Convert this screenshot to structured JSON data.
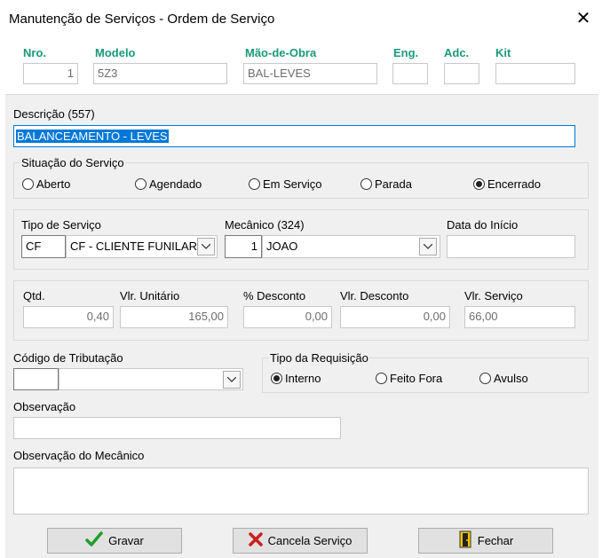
{
  "window": {
    "title": "Manutenção de Serviços - Ordem de Serviço",
    "close_glyph": "✕"
  },
  "header": {
    "nro_label": "Nro.",
    "nro_value": "1",
    "modelo_label": "Modelo",
    "modelo_value": "5Z3",
    "mao_obra_label": "Mão-de-Obra",
    "mao_obra_value": "BAL-LEVES",
    "eng_label": "Eng.",
    "eng_value": "",
    "adc_label": "Adc.",
    "adc_value": "",
    "kit_label": "Kit",
    "kit_value": ""
  },
  "descricao": {
    "label": "Descrição (557)",
    "value": "BALANCEAMENTO - LEVES"
  },
  "situacao": {
    "label": "Situação do Serviço",
    "options": [
      "Aberto",
      "Agendado",
      "Em Serviço",
      "Parada",
      "Encerrado"
    ],
    "selected": "Encerrado"
  },
  "tipo_servico": {
    "label": "Tipo de Serviço",
    "code": "CF",
    "name": "CF - CLIENTE FUNILARI"
  },
  "mecanico": {
    "label": "Mecânico (324)",
    "code": "1",
    "name": "JOAO"
  },
  "data_inicio": {
    "label": "Data do Início",
    "value": ""
  },
  "valores": {
    "qtd_label": "Qtd.",
    "qtd_value": "0,40",
    "vlr_unit_label": "Vlr. Unitário",
    "vlr_unit_value": "165,00",
    "desc_pct_label": "% Desconto",
    "desc_pct_value": "0,00",
    "vlr_desc_label": "Vlr. Desconto",
    "vlr_desc_value": "0,00",
    "vlr_serv_label": "Vlr. Serviço",
    "vlr_serv_value": "66,00"
  },
  "tributacao": {
    "label": "Código de Tributação",
    "code": "",
    "value": ""
  },
  "requisicao": {
    "label": "Tipo da Requisição",
    "options": [
      "Interno",
      "Feito Fora",
      "Avulso"
    ],
    "selected": "Interno"
  },
  "observacao": {
    "label": "Observação",
    "value": ""
  },
  "obs_mecanico": {
    "label": "Observação do Mecânico",
    "value": ""
  },
  "buttons": {
    "gravar": "Gravar",
    "cancela": "Cancela Serviço",
    "fechar": "Fechar"
  },
  "colors": {
    "accent_teal": "#1a9a7a",
    "selection": "#0078d7",
    "check_green": "#1f9e2c",
    "cross_red": "#c8201f"
  },
  "icons": {
    "gravar": "checkmark-icon",
    "cancela": "cross-icon",
    "fechar": "door-exit-icon"
  }
}
